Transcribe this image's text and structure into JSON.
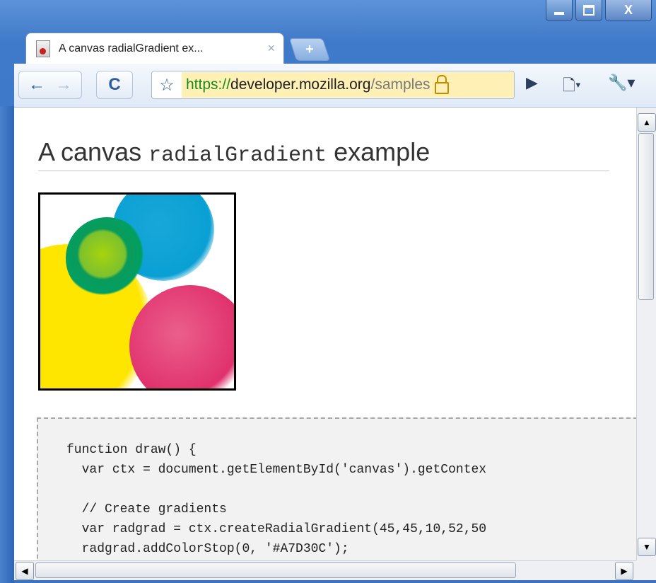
{
  "window": {
    "minimize_icon": "minimize-icon",
    "maximize_icon": "maximize-icon",
    "close_glyph": "X"
  },
  "tab": {
    "title": "A canvas radialGradient ex...",
    "close_glyph": "×",
    "new_tab_glyph": "+"
  },
  "toolbar": {
    "back_glyph": "←",
    "forward_glyph": "→",
    "reload_glyph": "C",
    "bookmark_glyph": "☆",
    "url_scheme": "https://",
    "url_host": "developer.mozilla.org",
    "url_path": "/samples",
    "go_glyph": "▶",
    "page_menu_glyph": "🗋▾",
    "tools_menu_glyph": "🔧▾"
  },
  "page": {
    "title_pre": "A canvas ",
    "title_code": "radialGradient",
    "title_post": " example",
    "code_lines": [
      "function draw() {",
      "  var ctx = document.getElementById('canvas').getContex",
      "",
      "  // Create gradients",
      "  var radgrad = ctx.createRadialGradient(45,45,10,52,50",
      "  radgrad.addColorStop(0, '#A7D30C');"
    ]
  },
  "scrollbars": {
    "up": "▲",
    "down": "▼",
    "left": "◀",
    "right": "▶"
  },
  "colors": {
    "accent_blue": "#3f79c9",
    "secure_url_bg": "#fff1b5",
    "circle_blue": "#19a7d8",
    "circle_green": "#019f62",
    "circle_lime": "#a7d30c",
    "circle_yellow": "#ffe600",
    "circle_pink": "#e1346e"
  }
}
